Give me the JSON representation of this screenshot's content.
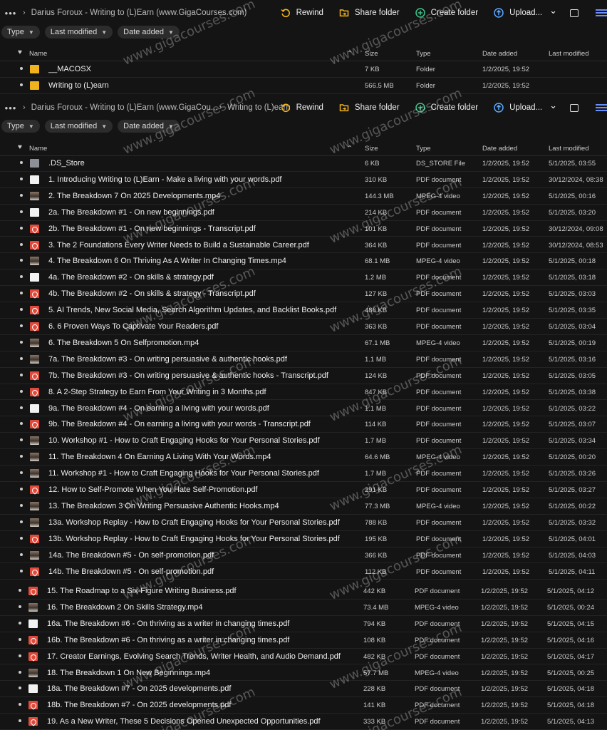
{
  "top": {
    "toolbar": {
      "crumbs": [
        "Darius Foroux - Writing to (L)Earn (www.GigaCourses.com)"
      ],
      "rewind": "Rewind",
      "share": "Share folder",
      "create": "Create folder",
      "upload": "Upload..."
    },
    "filters": [
      "Type",
      "Last modified",
      "Date added"
    ],
    "header": {
      "name": "Name",
      "size": "Size",
      "type": "Type",
      "date_added": "Date added",
      "last_modified": "Last modified"
    },
    "rows": [
      {
        "icon": "folder",
        "name": "__MACOSX",
        "size": "7 KB",
        "type": "Folder",
        "date_added": "1/2/2025, 19:52",
        "last_modified": ""
      },
      {
        "icon": "folder",
        "name": "Writing to (L)earn",
        "size": "566.5 MB",
        "type": "Folder",
        "date_added": "1/2/2025, 19:52",
        "last_modified": ""
      }
    ]
  },
  "sub": {
    "toolbar": {
      "crumbs": [
        "Darius Foroux - Writing to (L)Earn (www.GigaCou...",
        "Writing to (L)earn"
      ],
      "rewind": "Rewind",
      "share": "Share folder",
      "create": "Create folder",
      "upload": "Upload..."
    },
    "filters": [
      "Type",
      "Last modified",
      "Date added"
    ],
    "header": {
      "name": "Name",
      "size": "Size",
      "type": "Type",
      "date_added": "Date added",
      "last_modified": "Last modified"
    },
    "rows": [
      {
        "icon": "file",
        "name": ".DS_Store",
        "size": "6 KB",
        "type": "DS_STORE File",
        "date_added": "1/2/2025, 19:52",
        "last_modified": "5/1/2025, 03:55"
      },
      {
        "icon": "white",
        "name": "1. Introducing Writing to (L)Earn - Make a living with your words.pdf",
        "size": "310 KB",
        "type": "PDF document",
        "date_added": "1/2/2025, 19:52",
        "last_modified": "30/12/2024, 08:38"
      },
      {
        "icon": "mp4",
        "name": "2. The Breakdown 7 On 2025 Developments.mp4",
        "size": "144.3 MB",
        "type": "MPEG-4 video",
        "date_added": "1/2/2025, 19:52",
        "last_modified": "5/1/2025, 00:16"
      },
      {
        "icon": "white",
        "name": "2a. The Breakdown #1 - On new beginnings.pdf",
        "size": "214 KB",
        "type": "PDF document",
        "date_added": "1/2/2025, 19:52",
        "last_modified": "5/1/2025, 03:20"
      },
      {
        "icon": "pdf",
        "name": "2b. The Breakdown #1 - On new beginnings - Transcript.pdf",
        "size": "101 KB",
        "type": "PDF document",
        "date_added": "1/2/2025, 19:52",
        "last_modified": "30/12/2024, 09:08"
      },
      {
        "icon": "pdf",
        "name": "3. The 2 Foundations Every Writer Needs to Build a Sustainable Career.pdf",
        "size": "364 KB",
        "type": "PDF document",
        "date_added": "1/2/2025, 19:52",
        "last_modified": "30/12/2024, 08:53"
      },
      {
        "icon": "mp4",
        "name": "4. The Breakdown 6 On Thriving As A Writer In Changing Times.mp4",
        "size": "68.1 MB",
        "type": "MPEG-4 video",
        "date_added": "1/2/2025, 19:52",
        "last_modified": "5/1/2025, 00:18"
      },
      {
        "icon": "white",
        "name": "4a. The Breakdown #2 - On skills & strategy.pdf",
        "size": "1.2 MB",
        "type": "PDF document",
        "date_added": "1/2/2025, 19:52",
        "last_modified": "5/1/2025, 03:18"
      },
      {
        "icon": "pdf",
        "name": "4b. The Breakdown #2 - On skills & strategy - Transcript.pdf",
        "size": "127 KB",
        "type": "PDF document",
        "date_added": "1/2/2025, 19:52",
        "last_modified": "5/1/2025, 03:03"
      },
      {
        "icon": "pdf",
        "name": "5. AI Trends, New Social Media, Search Algorithm Updates, and Backlist Books.pdf",
        "size": "486 KB",
        "type": "PDF document",
        "date_added": "1/2/2025, 19:52",
        "last_modified": "5/1/2025, 03:35"
      },
      {
        "icon": "pdf",
        "name": "6. 6 Proven Ways To Captivate Your Readers.pdf",
        "size": "363 KB",
        "type": "PDF document",
        "date_added": "1/2/2025, 19:52",
        "last_modified": "5/1/2025, 03:04"
      },
      {
        "icon": "mp4",
        "name": "6. The Breakdown 5 On Selfpromotion.mp4",
        "size": "67.1 MB",
        "type": "MPEG-4 video",
        "date_added": "1/2/2025, 19:52",
        "last_modified": "5/1/2025, 00:19"
      },
      {
        "icon": "mp4",
        "name": "7a. The Breakdown #3 - On writing persuasive & authentic hooks.pdf",
        "size": "1.1 MB",
        "type": "PDF document",
        "date_added": "1/2/2025, 19:52",
        "last_modified": "5/1/2025, 03:16"
      },
      {
        "icon": "pdf",
        "name": "7b. The Breakdown #3 - On writing persuasive & authentic hooks - Transcript.pdf",
        "size": "124 KB",
        "type": "PDF document",
        "date_added": "1/2/2025, 19:52",
        "last_modified": "5/1/2025, 03:05"
      },
      {
        "icon": "pdf",
        "name": "8. A 2-Step Strategy to Earn From Your Writing in 3 Months.pdf",
        "size": "847 KB",
        "type": "PDF document",
        "date_added": "1/2/2025, 19:52",
        "last_modified": "5/1/2025, 03:38"
      },
      {
        "icon": "white",
        "name": "9a. The Breakdown #4 - On earning a living with your words.pdf",
        "size": "1.1 MB",
        "type": "PDF document",
        "date_added": "1/2/2025, 19:52",
        "last_modified": "5/1/2025, 03:22"
      },
      {
        "icon": "pdf",
        "name": "9b. The Breakdown #4 - On earning a living with your words - Transcript.pdf",
        "size": "114 KB",
        "type": "PDF document",
        "date_added": "1/2/2025, 19:52",
        "last_modified": "5/1/2025, 03:07"
      },
      {
        "icon": "mp4",
        "name": "10. Workshop #1 - How to Craft Engaging Hooks for Your Personal Stories.pdf",
        "size": "1.7 MB",
        "type": "PDF document",
        "date_added": "1/2/2025, 19:52",
        "last_modified": "5/1/2025, 03:34"
      },
      {
        "icon": "mp4",
        "name": "11. The Breakdown 4 On Earning A Living With Your Words.mp4",
        "size": "64.6 MB",
        "type": "MPEG-4 video",
        "date_added": "1/2/2025, 19:52",
        "last_modified": "5/1/2025, 00:20"
      },
      {
        "icon": "mp4",
        "name": "11. Workshop #1 - How to Craft Engaging Hooks for Your Personal Stories.pdf",
        "size": "1.7 MB",
        "type": "PDF document",
        "date_added": "1/2/2025, 19:52",
        "last_modified": "5/1/2025, 03:26"
      },
      {
        "icon": "pdf",
        "name": "12. How to Self-Promote When You Hate Self-Promotion.pdf",
        "size": "291 KB",
        "type": "PDF document",
        "date_added": "1/2/2025, 19:52",
        "last_modified": "5/1/2025, 03:27"
      },
      {
        "icon": "mp4",
        "name": "13. The Breakdown 3 On Writing Persuasive Authentic Hooks.mp4",
        "size": "77.3 MB",
        "type": "MPEG-4 video",
        "date_added": "1/2/2025, 19:52",
        "last_modified": "5/1/2025, 00:22"
      },
      {
        "icon": "mp4",
        "name": "13a. Workshop Replay - How to Craft Engaging Hooks for Your Personal Stories.pdf",
        "size": "788 KB",
        "type": "PDF document",
        "date_added": "1/2/2025, 19:52",
        "last_modified": "5/1/2025, 03:32"
      },
      {
        "icon": "pdf",
        "name": "13b. Workshop Replay - How to Craft Engaging Hooks for Your Personal Stories.pdf",
        "size": "195 KB",
        "type": "PDF document",
        "date_added": "1/2/2025, 19:52",
        "last_modified": "5/1/2025, 04:01"
      },
      {
        "icon": "mp4",
        "name": "14a. The Breakdown #5 - On self-promotion.pdf",
        "size": "366 KB",
        "type": "PDF document",
        "date_added": "1/2/2025, 19:52",
        "last_modified": "5/1/2025, 04:03"
      },
      {
        "icon": "pdf",
        "name": "14b. The Breakdown #5 - On self-promotion.pdf",
        "size": "112 KB",
        "type": "PDF document",
        "date_added": "1/2/2025, 19:52",
        "last_modified": "5/1/2025, 04:11"
      }
    ]
  },
  "lower": {
    "rows": [
      {
        "icon": "pdf",
        "name": "15. The Roadmap to a Six-Figure Writing Business.pdf",
        "size": "442 KB",
        "type": "PDF document",
        "date_added": "1/2/2025, 19:52",
        "last_modified": "5/1/2025, 04:12"
      },
      {
        "icon": "mp4",
        "name": "16. The Breakdown 2 On Skills Strategy.mp4",
        "size": "73.4 MB",
        "type": "MPEG-4 video",
        "date_added": "1/2/2025, 19:52",
        "last_modified": "5/1/2025, 00:24"
      },
      {
        "icon": "white",
        "name": "16a. The Breakdown #6 - On thriving as a writer in changing times.pdf",
        "size": "794 KB",
        "type": "PDF document",
        "date_added": "1/2/2025, 19:52",
        "last_modified": "5/1/2025, 04:15"
      },
      {
        "icon": "pdf",
        "name": "16b. The Breakdown #6 - On thriving as a writer in changing times.pdf",
        "size": "108 KB",
        "type": "PDF document",
        "date_added": "1/2/2025, 19:52",
        "last_modified": "5/1/2025, 04:16"
      },
      {
        "icon": "pdf",
        "name": "17. Creator Earnings, Evolving Search Trends, Writer Health, and Audio Demand.pdf",
        "size": "482 KB",
        "type": "PDF document",
        "date_added": "1/2/2025, 19:52",
        "last_modified": "5/1/2025, 04:17"
      },
      {
        "icon": "mp4",
        "name": "18. The Breakdown 1 On New Beginnings.mp4",
        "size": "57.7 MB",
        "type": "MPEG-4 video",
        "date_added": "1/2/2025, 19:52",
        "last_modified": "5/1/2025, 00:25"
      },
      {
        "icon": "white",
        "name": "18a. The Breakdown #7 - On 2025 developments.pdf",
        "size": "228 KB",
        "type": "PDF document",
        "date_added": "1/2/2025, 19:52",
        "last_modified": "5/1/2025, 04:18"
      },
      {
        "icon": "pdf",
        "name": "18b. The Breakdown #7 - On 2025 developments.pdf",
        "size": "141 KB",
        "type": "PDF document",
        "date_added": "1/2/2025, 19:52",
        "last_modified": "5/1/2025, 04:18"
      },
      {
        "icon": "pdf",
        "name": "19. As a New Writer, These 5 Decisions Opened Unexpected Opportunities.pdf",
        "size": "333 KB",
        "type": "PDF document",
        "date_added": "1/2/2025, 19:52",
        "last_modified": "5/1/2025, 04:13"
      }
    ]
  },
  "watermark": "www.gigacourses.com",
  "colors": {
    "accent": "#6a8dff",
    "rewind": "#f1b31c",
    "share": "#f1b31c",
    "create": "#3fc28a",
    "upload": "#5aa8ff",
    "pdf": "#e04a3a",
    "folder": "#f1b31c"
  }
}
